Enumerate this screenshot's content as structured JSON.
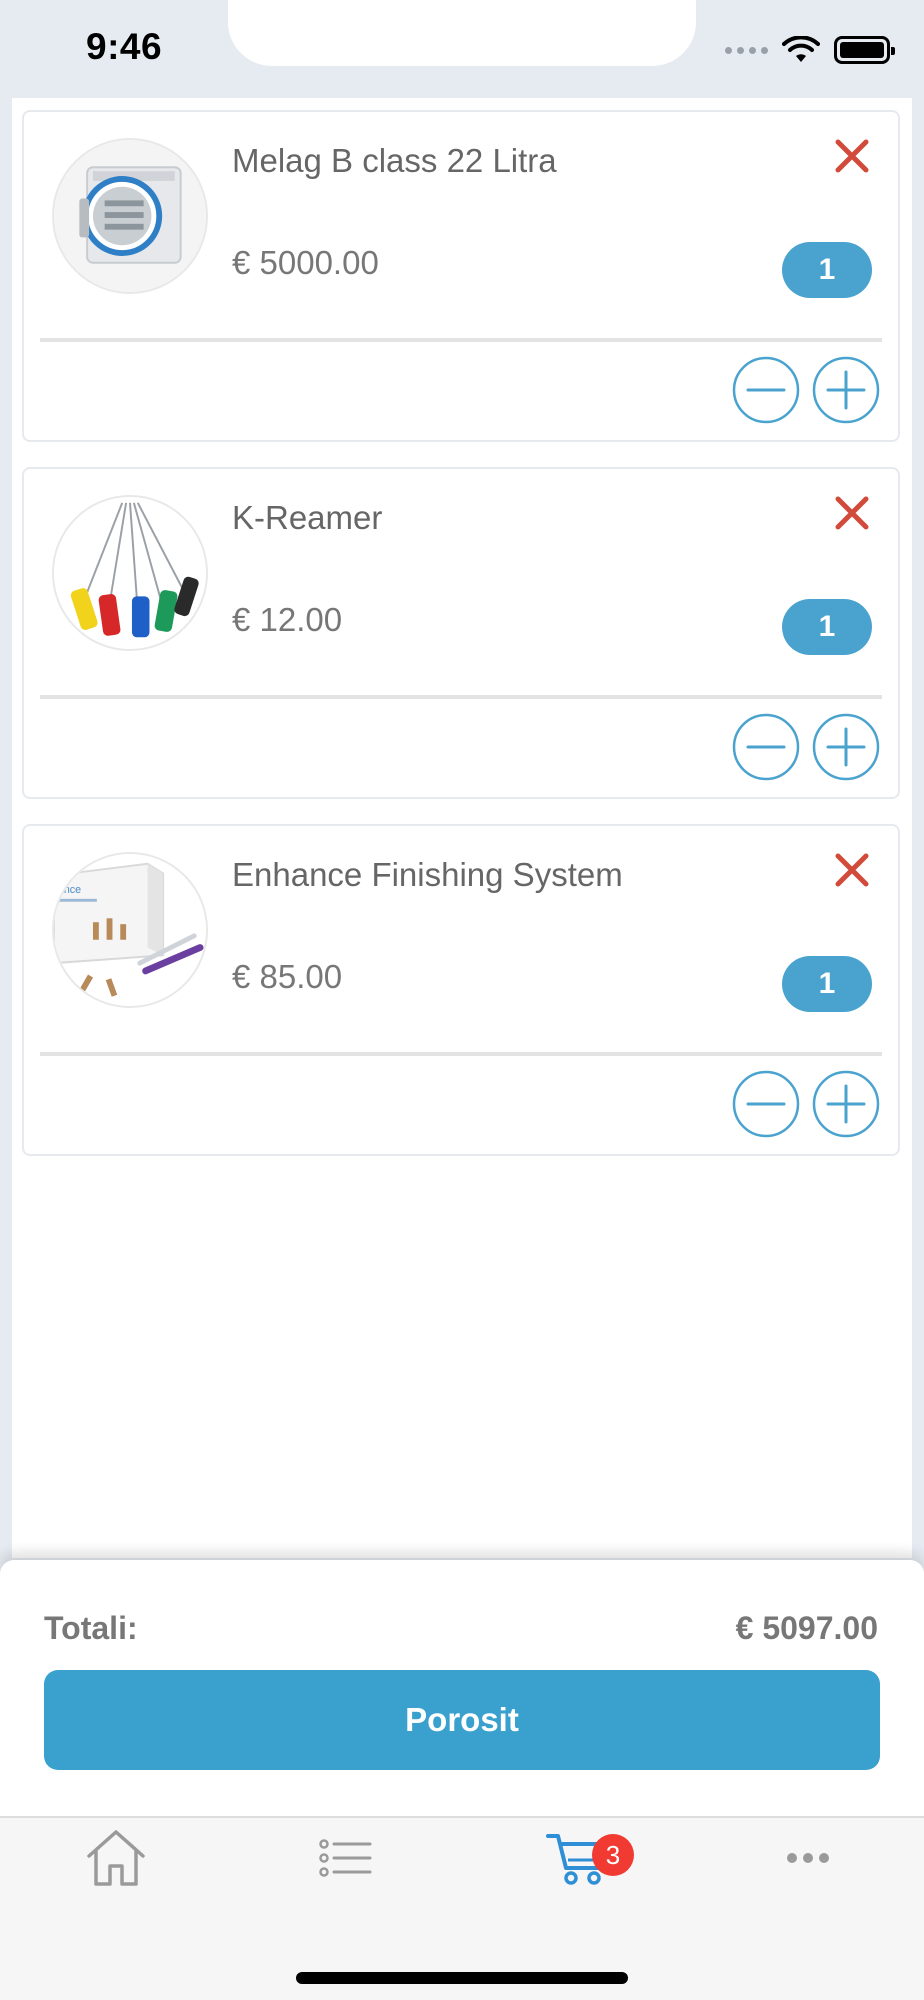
{
  "status_bar": {
    "time": "9:46"
  },
  "cart": {
    "items": [
      {
        "name": "Melag B class 22 Litra",
        "price": "€ 5000.00",
        "quantity": "1",
        "image": "autoclave-image"
      },
      {
        "name": "K-Reamer",
        "price": "€ 12.00",
        "quantity": "1",
        "image": "endodontic-files-image"
      },
      {
        "name": "Enhance Finishing System",
        "price": "€ 85.00",
        "quantity": "1",
        "image": "finishing-kit-image"
      }
    ]
  },
  "summary": {
    "total_label": "Totali:",
    "total_value": "€ 5097.00",
    "order_button": "Porosit"
  },
  "tabbar": {
    "tabs": [
      {
        "icon": "home-icon"
      },
      {
        "icon": "list-icon"
      },
      {
        "icon": "cart-icon",
        "active": true
      },
      {
        "icon": "more-icon"
      }
    ],
    "cart_badge": "3"
  },
  "colors": {
    "accent": "#3aa1cf",
    "remove": "#d24a3a",
    "badge": "#f03a32"
  },
  "box_brand_text": "ance"
}
